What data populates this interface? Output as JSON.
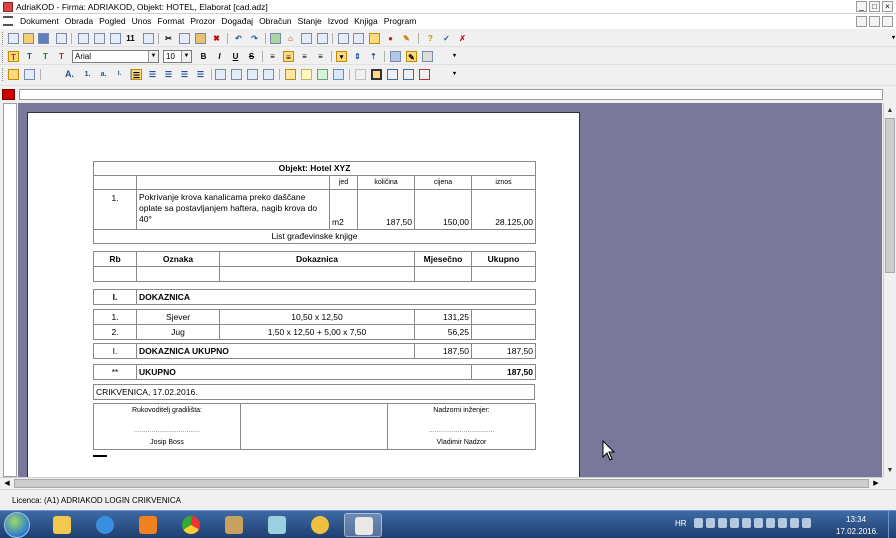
{
  "window": {
    "title": "AdriaKOD - Firma: ADRIAKOD,   Objekt: HOTEL, Elaborat [cad.adz]",
    "controls": [
      "_",
      "□",
      "×"
    ]
  },
  "menu": [
    "Dokument",
    "Obrada",
    "Pogled",
    "Unos",
    "Format",
    "Prozor",
    "Događaj",
    "Obračun",
    "Stanje",
    "Izvod",
    "Knjiga",
    "Program"
  ],
  "format_toolbar": {
    "font": "Arial",
    "size": "10",
    "text_styles": [
      "T",
      "T",
      "T",
      "T"
    ],
    "bold": "B",
    "italic": "I",
    "underline": "U",
    "strike": "S"
  },
  "standard_toolbar": {
    "page_number": "11"
  },
  "paragraph_toolbar": {
    "styles": [
      "A.",
      "1.",
      "a.",
      "I."
    ]
  },
  "document": {
    "header": {
      "title": "Objekt: Hotel XYZ",
      "col_jed": "jed",
      "col_kolicina": "količina",
      "col_cijena": "cijena",
      "col_iznos": "iznos",
      "item_no": "1.",
      "item_desc": "Pokrivanje krova kanalicama preko daščane oplate sa postavljanjem haftera, nagib krova do 40°",
      "item_unit": "m2",
      "item_qty": "187,50",
      "item_price": "150,00",
      "item_amount": "28.125,00",
      "sheet_title": "List građevinske knjige"
    },
    "columns": {
      "rb": "Rb",
      "oznaka": "Oznaka",
      "dokaznica": "Dokaznica",
      "mjesecno": "Mjesečno",
      "ukupno": "Ukupno"
    },
    "section": {
      "num": "I.",
      "label": "DOKAZNICA"
    },
    "rows": [
      {
        "rb": "1.",
        "oznaka": "Sjever",
        "dokaznica": "10,50 x 12,50",
        "mjesecno": "131,25"
      },
      {
        "rb": "2.",
        "oznaka": "Jug",
        "dokaznica": "1,50 x 12,50 + 5,00 x 7,50",
        "mjesecno": "56,25"
      }
    ],
    "section_total": {
      "num": "I.",
      "label": "DOKAZNICA UKUPNO",
      "mjesecno": "187,50",
      "ukupno": "187,50"
    },
    "grand_total": {
      "num": "**",
      "label": "UKUPNO",
      "ukupno": "187,50"
    },
    "place_date": "CRIKVENICA, 17.02.2016.",
    "signatures": {
      "left_title": "Rukovoditelj gradilišta:",
      "left_dots": "..................................",
      "left_name": "Josip Boss",
      "right_title": "Nadzorni inženjer:",
      "right_dots": "..................................",
      "right_name": "Vladimir Nadzor"
    }
  },
  "status": {
    "licence": "Licenca: (A1) ADRIAKOD LOGIN CRIKVENICA"
  },
  "taskbar": {
    "lang": "HR",
    "time": "13:34",
    "date": "17.02.2016."
  }
}
